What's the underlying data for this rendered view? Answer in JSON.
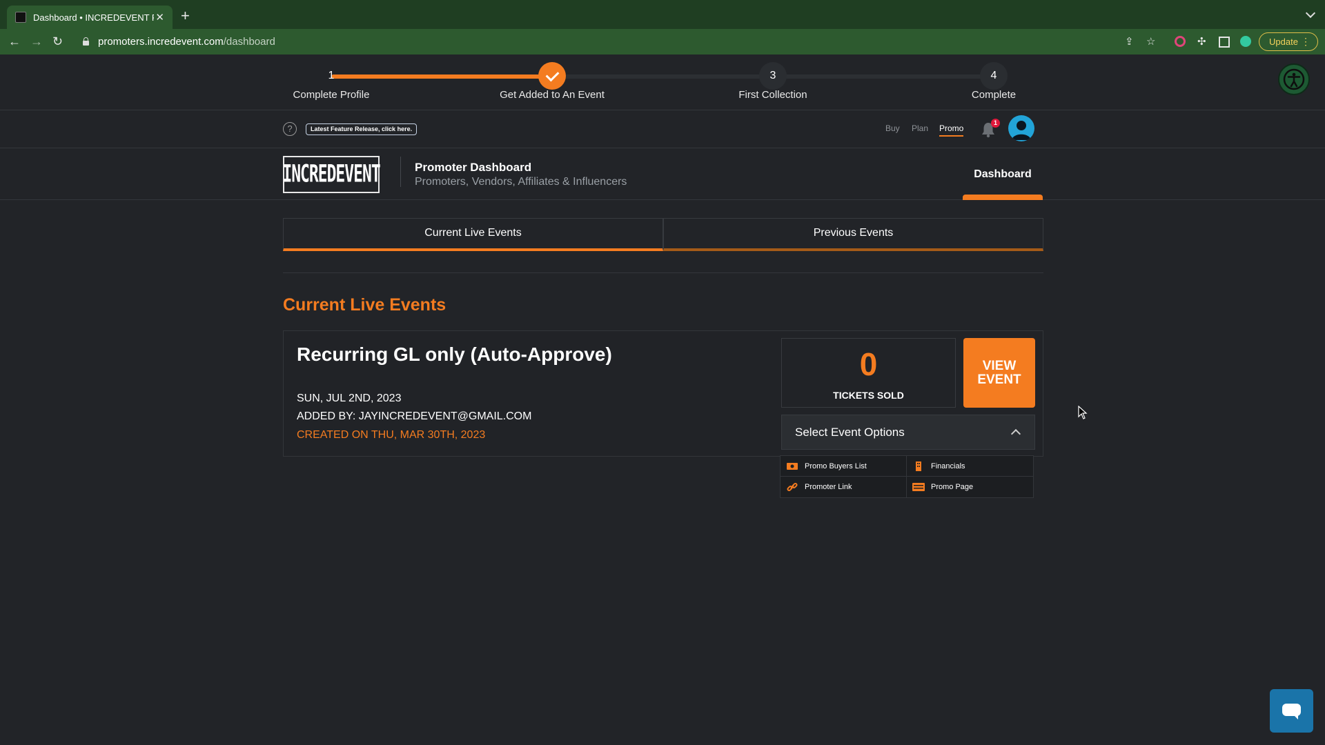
{
  "browser": {
    "tab_title": "Dashboard • INCREDEVENT Pr",
    "url_domain": "promoters.incredevent.com",
    "url_path": "/dashboard",
    "update_label": "Update"
  },
  "stepper": {
    "progress_fraction": 0.333,
    "steps": [
      {
        "number": "1",
        "label": "Complete Profile",
        "status": "complete"
      },
      {
        "number": "",
        "label": "Get Added to An Event",
        "status": "current-done"
      },
      {
        "number": "3",
        "label": "First Collection",
        "status": "pending"
      },
      {
        "number": "4",
        "label": "Complete",
        "status": "pending"
      }
    ]
  },
  "subnav": {
    "help_glyph": "?",
    "feature_badge": "Latest Feature Release, click here.",
    "modes": [
      "Buy",
      "Plan",
      "Promo"
    ],
    "active_mode": "Promo",
    "notification_count": "1"
  },
  "brand": {
    "logo_text": "INCREDEVENT",
    "title": "Promoter Dashboard",
    "subtitle": "Promoters, Vendors, Affiliates & Influencers",
    "nav_tab": "Dashboard"
  },
  "main": {
    "tabs": [
      "Current Live Events",
      "Previous Events"
    ],
    "section_title": "Current Live Events",
    "event": {
      "name": "Recurring GL only (Auto-Approve)",
      "date": "SUN, JUL 2ND, 2023",
      "added_by": "ADDED BY: JAYINCREDEVENT@GMAIL.COM",
      "created": "CREATED ON THU, MAR 30TH, 2023",
      "tickets_sold": "0",
      "tickets_label": "TICKETS SOLD",
      "view_button": "VIEW EVENT",
      "options_label": "Select Event Options",
      "options": [
        {
          "label": "Promo Buyers List",
          "icon": "money-icon"
        },
        {
          "label": "Financials",
          "icon": "building-icon"
        },
        {
          "label": "Promoter Link",
          "icon": "link-icon"
        },
        {
          "label": "Promo Page",
          "icon": "ticket-page-icon"
        }
      ]
    }
  },
  "colors": {
    "accent": "#f47c20",
    "background": "#222428",
    "browser_green": "#2d5a2f",
    "chat_blue": "#1a74a9"
  }
}
